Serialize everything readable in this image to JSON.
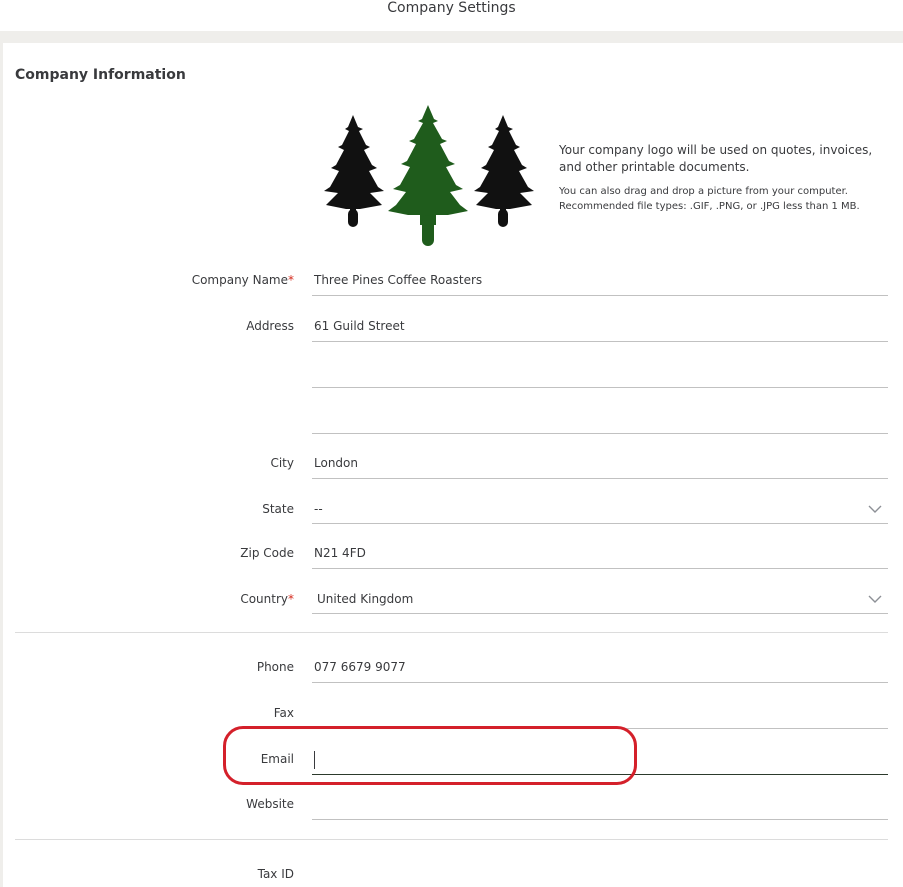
{
  "header": {
    "title": "Company Settings"
  },
  "section": {
    "title": "Company Information"
  },
  "logo": {
    "description": "Your company logo will be used on quotes, invoices, and other printable documents.",
    "drag_hint": "You can also drag and drop a picture from your computer.",
    "file_types": "Recommended file types: .GIF, .PNG, or .JPG less than 1 MB.",
    "colors": {
      "dark_tree": "#111111",
      "green_tree": "#1f5c1c"
    }
  },
  "form": {
    "company_name": {
      "label": "Company Name",
      "required_mark": "*",
      "value": "Three Pines Coffee Roasters"
    },
    "address": {
      "label": "Address",
      "line1": "61 Guild Street",
      "line2": "",
      "line3": ""
    },
    "city": {
      "label": "City",
      "value": "London"
    },
    "state": {
      "label": "State",
      "value": "--"
    },
    "zip": {
      "label": "Zip Code",
      "value": "N21 4FD"
    },
    "country": {
      "label": "Country",
      "required_mark": "*",
      "value": "United Kingdom"
    },
    "phone": {
      "label": "Phone",
      "value": "077 6679 9077"
    },
    "fax": {
      "label": "Fax",
      "value": ""
    },
    "email": {
      "label": "Email",
      "value": ""
    },
    "website": {
      "label": "Website",
      "value": ""
    },
    "tax_id": {
      "label": "Tax ID"
    }
  },
  "highlight_color": "#d4202a"
}
